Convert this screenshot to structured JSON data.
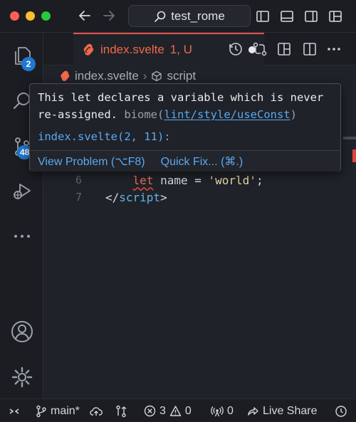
{
  "window": {
    "title": "test_rome"
  },
  "activity_bar": {
    "explorer_badge": "2",
    "scm_badge": "48"
  },
  "tab": {
    "label": "index.svelte",
    "status": "1, U"
  },
  "breadcrumb": {
    "file": "index.svelte",
    "symbol": "script"
  },
  "editor": {
    "lines": [
      {
        "number": "6",
        "keyword": "let",
        "rest": " name = ",
        "string": "'world'",
        "end": ";"
      },
      {
        "number": "7",
        "tag_open": "</",
        "tag_name": "script",
        "tag_close": ">"
      }
    ]
  },
  "hover": {
    "message": "This let declares a variable which is never re-assigned.",
    "source": "biome",
    "rule": "lint/style/useConst",
    "location": "index.svelte(2, 11):",
    "actions": [
      "View Problem (⌥F8)",
      "Quick Fix... (⌘.)"
    ]
  },
  "status_bar": {
    "branch": "main*",
    "errors": "3",
    "warnings": "0",
    "ports": "0",
    "live_share": "Live Share"
  },
  "colors": {
    "accent_blue": "#1f78d1",
    "svelte_orange": "#f0694a",
    "error_red": "#e0443a",
    "link_blue": "#5aa9f2"
  }
}
